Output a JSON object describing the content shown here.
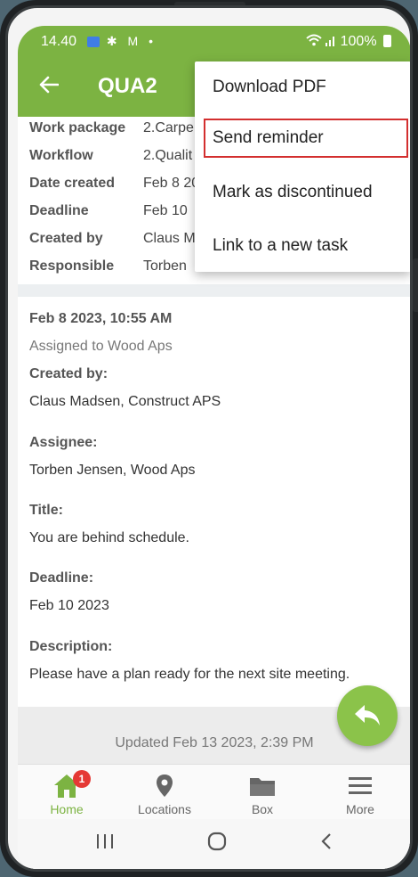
{
  "status_bar": {
    "time": "14.40",
    "left_icons": [
      "calendar-icon",
      "gear-icon",
      "gmail-icon",
      "dot"
    ],
    "battery": "100%"
  },
  "app_bar": {
    "title": "QUA2"
  },
  "info": {
    "rows": [
      {
        "key": "Work package",
        "value": "2.Carpe"
      },
      {
        "key": "Workflow",
        "value": "2.Qualit"
      },
      {
        "key": "Date created",
        "value": "Feb 8 20"
      },
      {
        "key": "Deadline",
        "value": "Feb 10 "
      },
      {
        "key": "Created by",
        "value": "Claus M"
      },
      {
        "key": "Responsible",
        "value": "Torben"
      }
    ]
  },
  "message": {
    "timestamp": "Feb 8 2023, 10:55 AM",
    "assigned": "Assigned to Wood Aps",
    "created_by_label": "Created by:",
    "created_by_value": "Claus Madsen, Construct APS",
    "assignee_label": "Assignee:",
    "assignee_value": "Torben Jensen, Wood Aps",
    "title_label": "Title:",
    "title_value": "You are behind schedule.",
    "deadline_label": "Deadline:",
    "deadline_value": "Feb 10 2023",
    "description_label": "Description:",
    "description_value": "Please have a plan ready for the next site meeting."
  },
  "updated": "Updated Feb 13 2023, 2:39 PM",
  "menu": {
    "items": [
      {
        "label": "Download PDF"
      },
      {
        "label": "Send reminder"
      },
      {
        "label": "Mark as discontinued"
      },
      {
        "label": "Link to a new task"
      }
    ]
  },
  "bottom_nav": {
    "items": [
      {
        "label": "Home",
        "icon": "home-icon",
        "badge": "1"
      },
      {
        "label": "Locations",
        "icon": "location-pin-icon"
      },
      {
        "label": "Box",
        "icon": "folder-icon"
      },
      {
        "label": "More",
        "icon": "hamburger-menu-icon"
      }
    ]
  },
  "colors": {
    "accent": "#7cb342",
    "fab": "#8bc34a",
    "badge": "#e53935",
    "highlight_outline": "#d32f2f"
  }
}
